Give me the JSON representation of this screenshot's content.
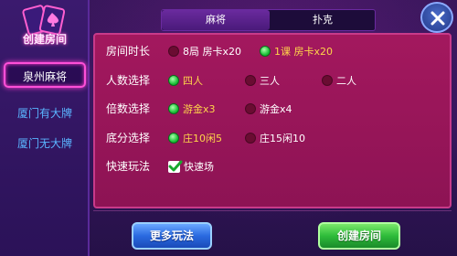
{
  "sidebar": {
    "title": "创建房间",
    "items": [
      {
        "label": "泉州麻将",
        "active": true
      },
      {
        "label": "厦门有大牌",
        "active": false
      },
      {
        "label": "厦门无大牌",
        "active": false
      }
    ]
  },
  "tabs": [
    {
      "label": "麻将",
      "active": true
    },
    {
      "label": "扑克",
      "active": false
    }
  ],
  "rows": {
    "room_duration": {
      "label": "房间时长",
      "options": [
        {
          "label": "8局 房卡x20",
          "selected": false
        },
        {
          "label": "1课 房卡x20",
          "selected": true
        }
      ]
    },
    "players": {
      "label": "人数选择",
      "options": [
        {
          "label": "四人",
          "selected": true
        },
        {
          "label": "三人",
          "selected": false
        },
        {
          "label": "二人",
          "selected": false
        }
      ]
    },
    "multiplier": {
      "label": "倍数选择",
      "options": [
        {
          "label": "游金x3",
          "selected": true
        },
        {
          "label": "游金x4",
          "selected": false
        }
      ]
    },
    "base_score": {
      "label": "底分选择",
      "options": [
        {
          "label": "庄10闲5",
          "selected": true
        },
        {
          "label": "庄15闲10",
          "selected": false
        }
      ]
    },
    "quick_play": {
      "label": "快速玩法",
      "options": [
        {
          "label": "快速场",
          "checked": true
        }
      ]
    }
  },
  "buttons": {
    "more": "更多玩法",
    "create": "创建房间"
  },
  "colors": {
    "selected_text": "#ffd54a",
    "radio_on": "#1ec23a",
    "panel_bg": "#a3185e",
    "active_border": "#ff4fd8"
  }
}
